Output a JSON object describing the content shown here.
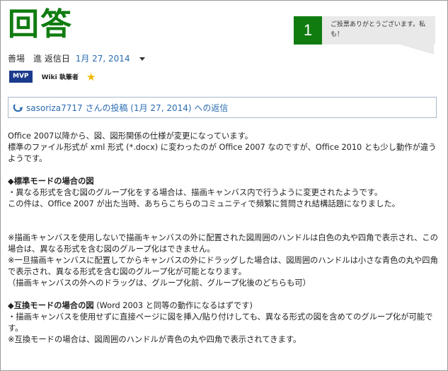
{
  "title": "回答",
  "vote": {
    "count": "1",
    "thanks": "ご投票ありがとうございます。私も！"
  },
  "meta": {
    "author": "善場　進",
    "replied_label": "返信日",
    "date": "1月 27, 2014"
  },
  "badges": {
    "mvp": "MVP",
    "wiki": "Wiki 執筆者"
  },
  "reply_link": "sasoriza7717 さんの投稿 (1月 27, 2014) への返信",
  "content": {
    "intro1": "Office 2007以降から、図、図形関係の仕様が変更になっています。",
    "intro2": "標準のファイル形式が xml 形式 (*.docx) に変わったのが Office 2007 なのですが、Office 2010 とも少し動作が違うようです。",
    "std_heading": "◆標準モードの場合の図",
    "std1": "・異なる形式を含む図のグループ化をする場合は、描画キャンバス内で行うように変更されたようです。",
    "std2": "この件は、Office 2007 が出た当時、あちらこちらのコミュニティで頻繁に質問され結構話題になりました。",
    "note1": "※描画キャンバスを使用しないで描画キャンバスの外に配置された図周囲のハンドルは白色の丸や四角で表示され、この場合は、異なる形式を含む図のグループ化はできません。",
    "note2": "※一旦描画キャンバスに配置してからキャンバスの外にドラッグした場合は、図周囲のハンドルは小さな青色の丸や四角で表示され、異なる形式を含む図のグループ化が可能となります。",
    "note3": "（描画キャンバスの外へのドラッグは、グループ化前、グループ化後のどちらも可）",
    "compat_heading": "◆互換モードの場合の図",
    "compat_heading_rest": " (Word 2003 と同等の動作になるはずです)",
    "compat1": "・描画キャンバスを使用せずに直接ページに図を挿入/貼り付けしても、異なる形式の図を含めてのグループ化が可能です。",
    "compat2": "※互換モードの場合は、図周囲のハンドルが青色の丸や四角で表示されてきます。"
  },
  "colors": {
    "accent_green": "#107c10",
    "link_blue": "#2b6cb0",
    "mvp_blue": "#1b3a8c",
    "star": "#f2b800"
  },
  "icons": [
    "reply-arrow-icon",
    "star-icon",
    "caret-down-icon"
  ]
}
